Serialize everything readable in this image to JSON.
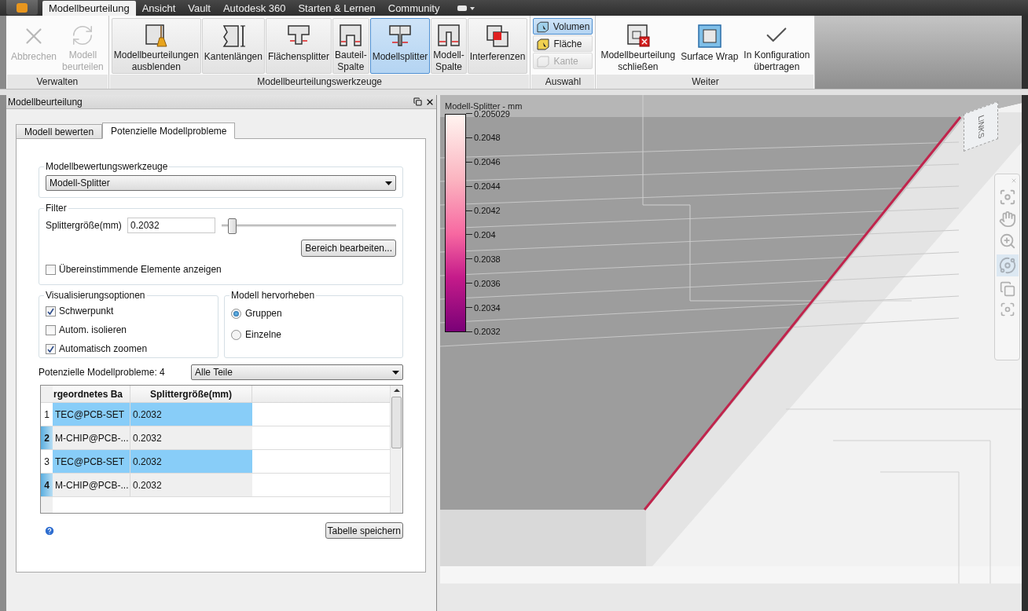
{
  "app_tabs": [
    {
      "label": "Modellbeurteilung",
      "selected": true
    },
    {
      "label": "Ansicht",
      "selected": false
    },
    {
      "label": "Vault",
      "selected": false
    },
    {
      "label": "Autodesk 360",
      "selected": false
    },
    {
      "label": "Starten & Lernen",
      "selected": false
    },
    {
      "label": "Community",
      "selected": false
    }
  ],
  "ribbon_groups": [
    {
      "title": "Verwalten",
      "buttons": [
        {
          "label": "Abbrechen",
          "kind": "large",
          "disabled": true,
          "selected": false
        },
        {
          "label": "Modell\nbeurteilen",
          "kind": "large",
          "disabled": true,
          "selected": false
        }
      ]
    },
    {
      "title": "Modellbeurteilungswerkzeuge",
      "buttons": [
        {
          "label": "Modellbeurteilungen\nausblenden",
          "kind": "large",
          "disabled": false,
          "selected": false
        },
        {
          "label": "Kantenlängen",
          "kind": "large",
          "disabled": false,
          "selected": false
        },
        {
          "label": "Flächensplitter",
          "kind": "large",
          "disabled": false,
          "selected": false
        },
        {
          "label": "Bauteil-\nSpalte",
          "kind": "large",
          "disabled": false,
          "selected": false
        },
        {
          "label": "Modellsplitter",
          "kind": "large",
          "disabled": false,
          "selected": true
        },
        {
          "label": "Modell-\nSpalte",
          "kind": "large",
          "disabled": false,
          "selected": false
        },
        {
          "label": "Interferenzen",
          "kind": "large",
          "disabled": false,
          "selected": false
        }
      ]
    },
    {
      "title": "Auswahl",
      "buttons": [
        {
          "label": "Volumen",
          "kind": "small",
          "disabled": false,
          "selected": true
        },
        {
          "label": "Fläche",
          "kind": "small",
          "disabled": false,
          "selected": false
        },
        {
          "label": "Kante",
          "kind": "small",
          "disabled": true,
          "selected": false
        }
      ]
    },
    {
      "title": "Weiter",
      "buttons": [
        {
          "label": "Modellbeurteilung\nschließen",
          "kind": "large",
          "disabled": false,
          "selected": false
        },
        {
          "label": "Surface Wrap",
          "kind": "large",
          "disabled": false,
          "selected": false
        },
        {
          "label": "In Konfiguration\nübertragen",
          "kind": "large",
          "disabled": false,
          "selected": false
        }
      ]
    }
  ],
  "panel": {
    "title": "Modellbeurteilung",
    "tabs": [
      {
        "label": "Modell bewerten",
        "selected": false
      },
      {
        "label": "Potenzielle Modellprobleme",
        "selected": true
      }
    ],
    "tools": {
      "title": "Modellbewertungswerkzeuge",
      "value": "Modell-Splitter"
    },
    "filter": {
      "title": "Filter",
      "size_label": "Splittergröße(mm)",
      "size_value": "0.2032",
      "level": 0.04,
      "range_button": "Bereich bearbeiten...",
      "match": {
        "label": "Übereinstimmende Elemente anzeigen",
        "checked": false
      }
    },
    "visualization": {
      "title": "Visualisierungsoptionen",
      "options": [
        {
          "label": "Schwerpunkt",
          "checked": true
        },
        {
          "label": "Autom. isolieren",
          "checked": false
        },
        {
          "label": "Automatisch zoomen",
          "checked": true
        }
      ]
    },
    "highlight": {
      "title": "Modell hervorheben",
      "options": [
        {
          "label": "Gruppen",
          "selected": true
        },
        {
          "label": "Einzelne",
          "selected": false
        }
      ]
    },
    "problems_label": "Potenzielle Modellprobleme: 4",
    "problems_filter": "Alle Teile",
    "table": {
      "columns": [
        "rgeordnetes Ba",
        "Splittergröße(mm)"
      ],
      "rows": [
        {
          "index": "1",
          "part": "TEC@PCB-SET",
          "size": "0.2032",
          "selected": false,
          "highlighted": true
        },
        {
          "index": "2",
          "part": "M-CHIP@PCB-...",
          "size": "0.2032",
          "selected": true,
          "highlighted": false
        },
        {
          "index": "3",
          "part": "TEC@PCB-SET",
          "size": "0.2032",
          "selected": false,
          "highlighted": true
        },
        {
          "index": "4",
          "part": "M-CHIP@PCB-...",
          "size": "0.2032",
          "selected": true,
          "highlighted": false
        }
      ]
    },
    "save_button": "Tabelle speichern"
  },
  "viewport": {
    "legend": {
      "title": "Modell-Splitter - mm",
      "ticks": [
        "0.205029",
        "0.2048",
        "0.2046",
        "0.2044",
        "0.2042",
        "0.204",
        "0.2038",
        "0.2036",
        "0.2034",
        "0.2032"
      ]
    },
    "viewcube_label": "LINKS"
  }
}
